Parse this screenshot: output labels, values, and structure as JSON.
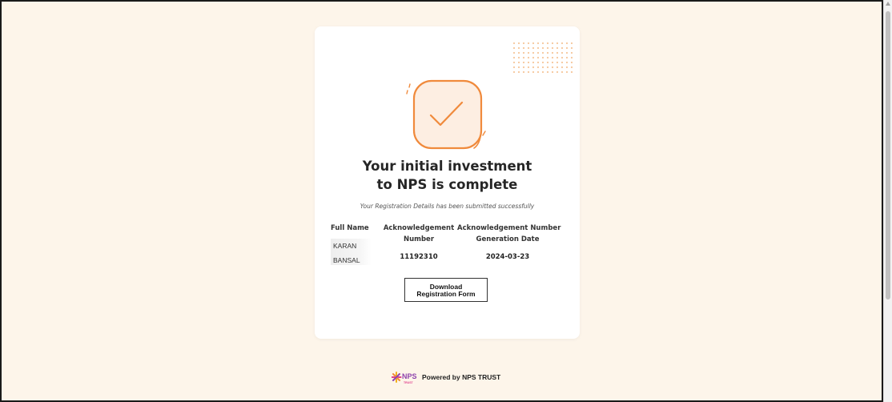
{
  "success_card": {
    "title_line1": "Your initial investment",
    "title_line2": "to NPS is complete",
    "subtitle": "Your Registration Details has been submitted successfully",
    "icon": "checkmark-icon"
  },
  "details": {
    "full_name_header": "Full Name",
    "ack_number_header_line1": "Acknowledgement",
    "ack_number_header_line2": "Number",
    "ack_date_header_line1": "Acknowledgement Number",
    "ack_date_header_line2": "Generation Date",
    "full_name_line1": "KARAN",
    "full_name_line2": "BANSAL",
    "ack_number": "11192310",
    "ack_date": "2024-03-23"
  },
  "actions": {
    "download_line1": "Download",
    "download_line2": "Registration Form"
  },
  "footer": {
    "logo_text": "NPS",
    "logo_subtext": "TRUST",
    "powered_by": "Powered by NPS TRUST"
  },
  "colors": {
    "page_background": "#fdf5ea",
    "accent_orange": "#f08a3c",
    "card_background": "#ffffff"
  }
}
